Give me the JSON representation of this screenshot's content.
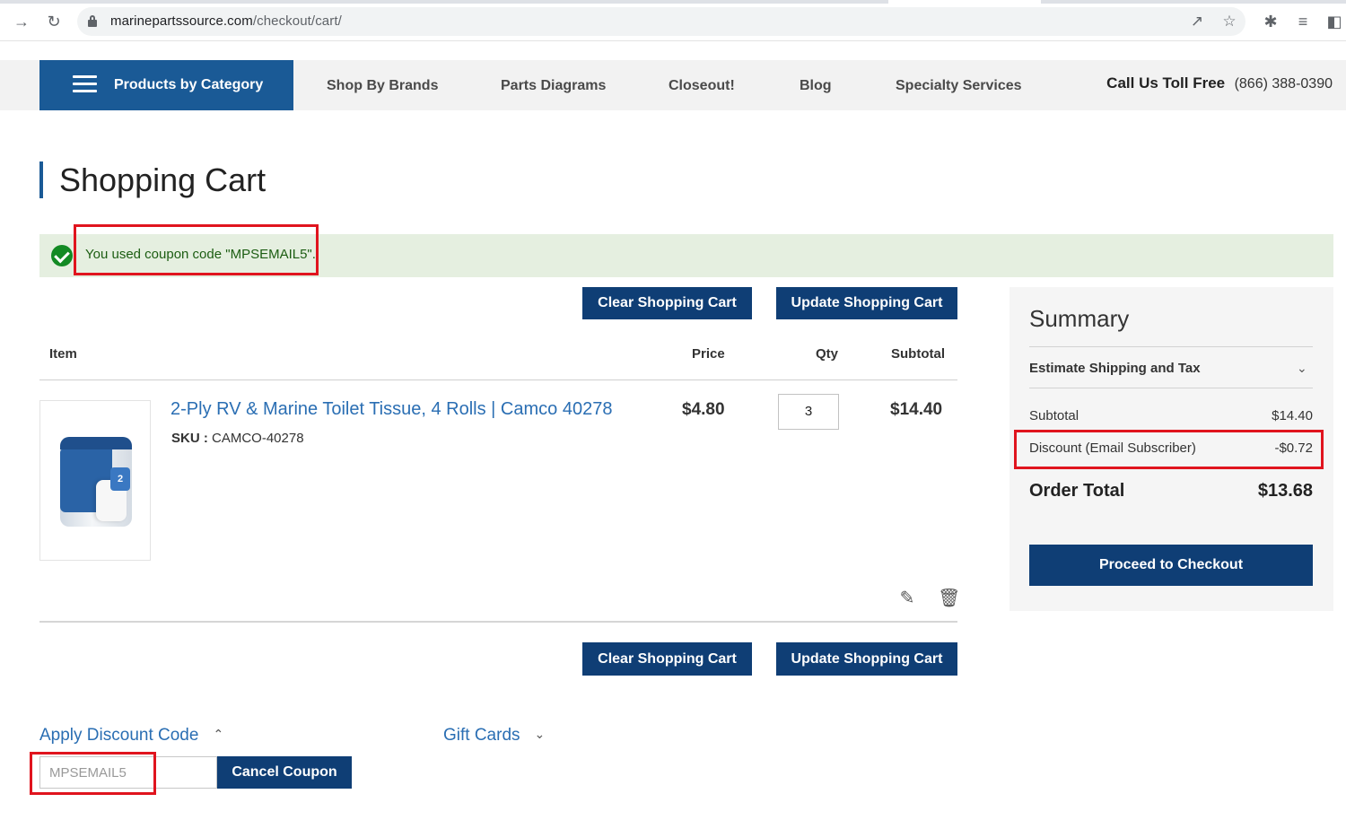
{
  "browser": {
    "url_domain": "marinepartssource.com",
    "url_path": "/checkout/cart/"
  },
  "nav": {
    "category_label": "Products by Category",
    "items": [
      "Shop By Brands",
      "Parts Diagrams",
      "Closeout!",
      "Blog",
      "Specialty Services"
    ],
    "call_label": "Call Us Toll Free",
    "call_number": "(866) 388-0390"
  },
  "page": {
    "title": "Shopping Cart"
  },
  "message": {
    "text": "You used coupon code \"MPSEMAIL5\"."
  },
  "cart": {
    "clear_label": "Clear Shopping Cart",
    "update_label": "Update Shopping Cart",
    "columns": {
      "item": "Item",
      "price": "Price",
      "qty": "Qty",
      "subtotal": "Subtotal"
    },
    "items": [
      {
        "name": "2-Ply RV & Marine Toilet Tissue, 4 Rolls | Camco 40278",
        "sku_label": "SKU :",
        "sku": "CAMCO-40278",
        "price": "$4.80",
        "qty": "3",
        "subtotal": "$14.40",
        "image_badge": "2"
      }
    ]
  },
  "summary": {
    "title": "Summary",
    "estimate_label": "Estimate Shipping and Tax",
    "subtotal_label": "Subtotal",
    "subtotal_value": "$14.40",
    "discount_label": "Discount (Email Subscriber)",
    "discount_value": "-$0.72",
    "total_label": "Order Total",
    "total_value": "$13.68",
    "checkout_label": "Proceed to Checkout"
  },
  "discount": {
    "toggle_label": "Apply Discount Code",
    "code_value": "MPSEMAIL5",
    "cancel_label": "Cancel Coupon"
  },
  "gift_cards": {
    "toggle_label": "Gift Cards"
  },
  "colors": {
    "brand_blue": "#1a5a96",
    "button_navy": "#0f3e75",
    "link_blue": "#2a6eb3",
    "success_bg": "#e5efe0",
    "success_text": "#1c5d12",
    "highlight_red": "#e0141e"
  }
}
